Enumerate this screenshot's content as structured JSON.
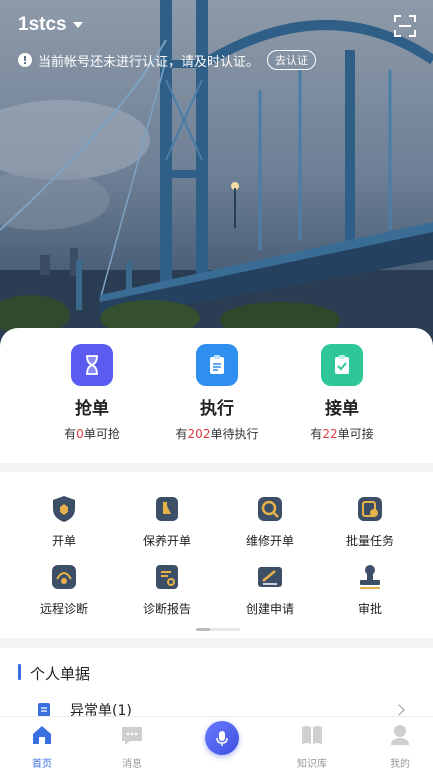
{
  "header": {
    "account_name": "1stcs",
    "notice_text": "当前帐号还未进行认证，请及时认证。",
    "verify_label": "去认证"
  },
  "orders": [
    {
      "title": "抢单",
      "prefix": "有",
      "count": "0",
      "suffix": "单可抢",
      "icon": "hourglass-icon",
      "color": "#5a5cf0"
    },
    {
      "title": "执行",
      "prefix": "有",
      "count": "202",
      "suffix": "单待执行",
      "icon": "clipboard-icon",
      "color": "#2f8ff0"
    },
    {
      "title": "接单",
      "prefix": "有",
      "count": "22",
      "suffix": "单可接",
      "icon": "clipboard-check-icon",
      "color": "#2fc79a"
    }
  ],
  "functions": [
    {
      "label": "开单",
      "icon": "shield-icon"
    },
    {
      "label": "保养开单",
      "icon": "maintenance-doc-icon"
    },
    {
      "label": "维修开单",
      "icon": "repair-search-icon"
    },
    {
      "label": "批量任务",
      "icon": "batch-task-icon"
    },
    {
      "label": "远程诊断",
      "icon": "remote-diagnosis-icon"
    },
    {
      "label": "诊断报告",
      "icon": "diagnosis-report-icon"
    },
    {
      "label": "创建申请",
      "icon": "create-request-icon"
    },
    {
      "label": "审批",
      "icon": "approval-stamp-icon"
    }
  ],
  "personal_docs": {
    "title": "个人单据",
    "items": [
      {
        "label": "异常单(1)",
        "icon": "document-icon"
      }
    ]
  },
  "tabbar": [
    {
      "label": "首页",
      "icon": "home-icon",
      "active": true
    },
    {
      "label": "消息",
      "icon": "message-icon",
      "active": false
    },
    {
      "label": "",
      "icon": "microphone-icon",
      "active": false
    },
    {
      "label": "知识库",
      "icon": "book-icon",
      "active": false
    },
    {
      "label": "我的",
      "icon": "user-icon",
      "active": false
    }
  ],
  "colors": {
    "accent": "#3a6fe0",
    "highlight_number": "#e0393e"
  }
}
